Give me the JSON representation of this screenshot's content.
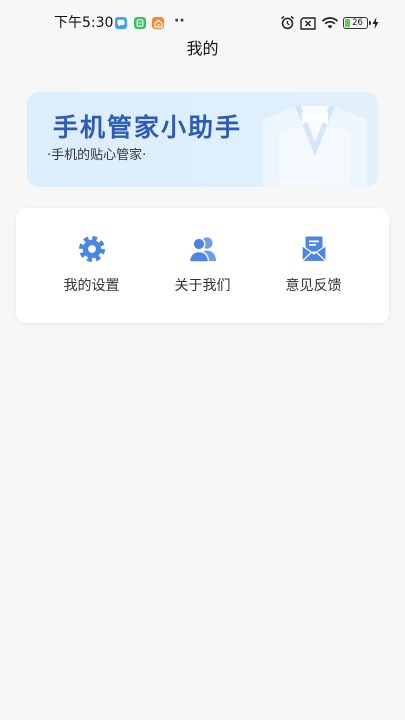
{
  "status_bar": {
    "time": "下午5:30",
    "notification_icons": [
      "message-app-icon",
      "green-app-icon",
      "home-app-icon"
    ],
    "more_indicator": "··",
    "system_icons": [
      "alarm-icon",
      "no-sim-icon",
      "wifi-icon",
      "battery-icon",
      "charging-icon"
    ],
    "battery_level": "26"
  },
  "header": {
    "title": "我的"
  },
  "banner": {
    "title": "手机管家小助手",
    "subtitle": "·手机的贴心管家·",
    "illustration": "shirt-bowtie-illustration"
  },
  "menu": {
    "items": [
      {
        "label": "我的设置",
        "icon": "gear-icon"
      },
      {
        "label": "关于我们",
        "icon": "users-icon"
      },
      {
        "label": "意见反馈",
        "icon": "mail-icon"
      }
    ]
  },
  "colors": {
    "page_background": "#f7f7f7",
    "banner_background": "#dcedfc",
    "banner_title": "#2d5cb8",
    "icon_accent": "#4b86e4",
    "card_background": "#ffffff",
    "text_primary": "#222222",
    "battery_fill": "#5ccf4f"
  }
}
